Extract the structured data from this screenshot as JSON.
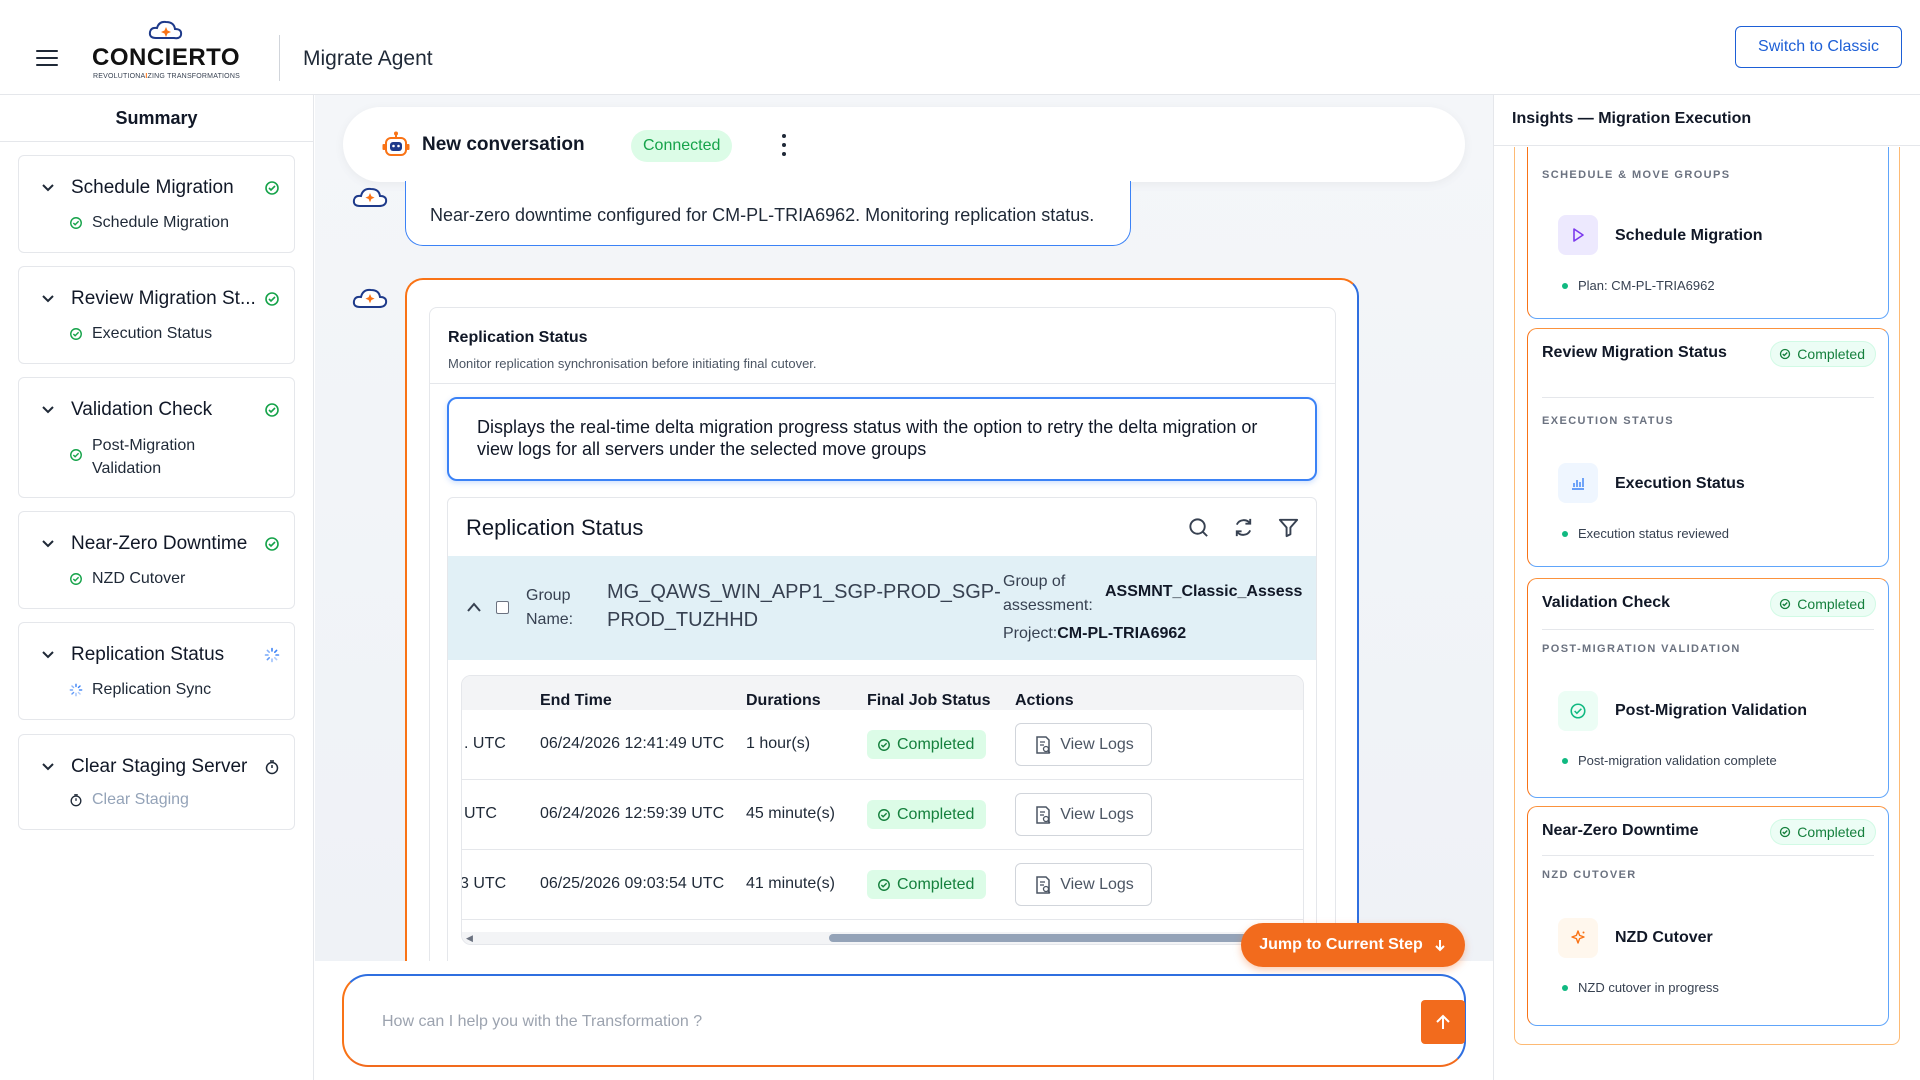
{
  "header": {
    "logo_text": "CONCIERTO",
    "tagline_pre": "REVOLUTIONA",
    "tagline_mid": "I",
    "tagline_post": "ZING TRANSFORMATIONS",
    "app_title": "Migrate Agent",
    "switch_label": "Switch to Classic"
  },
  "sidebar": {
    "title": "Summary",
    "steps": [
      {
        "title": "Schedule Migration",
        "sub": "Schedule Migration",
        "status": "done"
      },
      {
        "title": "Review Migration St...",
        "sub": "Execution Status",
        "status": "done"
      },
      {
        "title": "Validation Check",
        "sub": "Post-Migration Validation",
        "status": "done"
      },
      {
        "title": "Near-Zero Downtime",
        "sub": "NZD Cutover",
        "status": "done"
      },
      {
        "title": "Replication Status",
        "sub": "Replication Sync",
        "status": "in-progress"
      },
      {
        "title": "Clear Staging Server",
        "sub": "Clear Staging",
        "status": "pending"
      }
    ]
  },
  "conversation": {
    "title": "New conversation",
    "status": "Connected",
    "message": "Near-zero downtime configured for CM-PL-TRIA6962. Monitoring replication status."
  },
  "replication_card": {
    "title": "Replication Status",
    "subtitle": "Monitor replication synchronisation before initiating final cutover.",
    "description": "Displays the real-time delta migration progress status with the option to retry the delta migration or view logs for all servers under the selected move groups",
    "panel_title": "Replication Status",
    "group": {
      "label": "Group Name:",
      "name": "MG_QAWS_WIN_APP1_SGP-PROD_SGP-PROD_TUZHHD",
      "assessment_label": "Group of assessment:",
      "assessment_value": "ASSMNT_Classic_Assess",
      "project_label": "Project:",
      "project_value": "CM-PL-TRIA6962"
    },
    "columns": [
      "End Time",
      "Durations",
      "Final Job Status",
      "Actions"
    ],
    "rows": [
      {
        "start_tail": ". UTC",
        "end": "06/24/2026 12:41:49 UTC",
        "duration": "1 hour(s)",
        "status": "Completed",
        "action": "View Logs"
      },
      {
        "start_tail": "UTC",
        "end": "06/24/2026 12:59:39 UTC",
        "duration": "45 minute(s)",
        "status": "Completed",
        "action": "View Logs"
      },
      {
        "start_tail": "3 UTC",
        "end": "06/25/2026 09:03:54 UTC",
        "duration": "41 minute(s)",
        "status": "Completed",
        "action": "View Logs"
      }
    ]
  },
  "jump_label": "Jump to Current Step",
  "composer": {
    "placeholder": "How can I help you with the Transformation ?"
  },
  "insights": {
    "title": "Insights — Migration Execution",
    "cards": [
      {
        "title": "",
        "status": "",
        "section": "SCHEDULE & MOVE GROUPS",
        "item": "Schedule Migration",
        "note": "Plan: CM-PL-TRIA6962"
      },
      {
        "title": "Review Migration Status",
        "status": "Completed",
        "section": "EXECUTION STATUS",
        "item": "Execution Status",
        "note": "Execution status reviewed"
      },
      {
        "title": "Validation Check",
        "status": "Completed",
        "section": "POST-MIGRATION VALIDATION",
        "item": "Post-Migration Validation",
        "note": "Post-migration validation complete"
      },
      {
        "title": "Near-Zero Downtime",
        "status": "Completed",
        "section": "NZD CUTOVER",
        "item": "NZD Cutover",
        "note": "NZD cutover in progress"
      }
    ]
  },
  "colors": {
    "accent": "#f26b1d",
    "primary": "#2f6fe0",
    "success": "#16a34a"
  }
}
